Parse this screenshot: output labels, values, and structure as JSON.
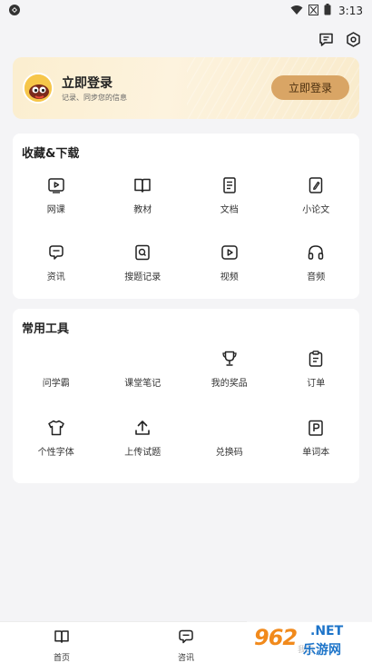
{
  "status_bar": {
    "time": "3:13"
  },
  "login": {
    "title": "立即登录",
    "subtitle": "记录、同步您的信息",
    "button": "立即登录"
  },
  "favorites": {
    "title": "收藏&下载",
    "items": [
      {
        "label": "网课",
        "icon": "video-course-icon"
      },
      {
        "label": "教材",
        "icon": "book-icon"
      },
      {
        "label": "文档",
        "icon": "document-icon"
      },
      {
        "label": "小论文",
        "icon": "paper-pen-icon"
      },
      {
        "label": "资讯",
        "icon": "news-icon"
      },
      {
        "label": "搜题记录",
        "icon": "search-record-icon"
      },
      {
        "label": "视频",
        "icon": "video-icon"
      },
      {
        "label": "音频",
        "icon": "headphones-icon"
      }
    ]
  },
  "tools": {
    "title": "常用工具",
    "items": [
      {
        "label": "问学霸",
        "icon": ""
      },
      {
        "label": "课堂笔记",
        "icon": ""
      },
      {
        "label": "我的奖品",
        "icon": "trophy-icon"
      },
      {
        "label": "订单",
        "icon": "clipboard-icon"
      },
      {
        "label": "个性字体",
        "icon": "tshirt-icon"
      },
      {
        "label": "上传试题",
        "icon": "upload-icon"
      },
      {
        "label": "兑换码",
        "icon": ""
      },
      {
        "label": "单词本",
        "icon": "vocabulary-icon"
      }
    ]
  },
  "bottom_nav": {
    "home": "首页",
    "news": "咨讯",
    "third": "我的"
  },
  "watermark": {
    "number": "962",
    "net": ".NET",
    "cn": "乐游网"
  }
}
